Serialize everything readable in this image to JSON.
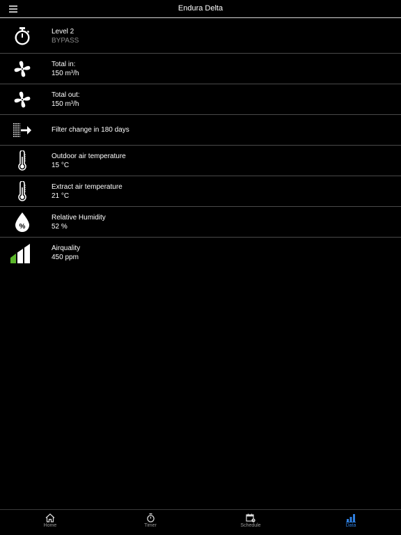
{
  "header": {
    "title": "Endura Delta",
    "menu_icon": "hamburger-menu-icon"
  },
  "rows": [
    {
      "icon": "stopwatch-icon",
      "line1": "Level 2",
      "line2": "BYPASS"
    },
    {
      "icon": "fan-icon",
      "line1": "Total in:",
      "line2_value": "150 m",
      "line2_sup": "3",
      "line2_unit": "/h"
    },
    {
      "icon": "fan-icon",
      "line1": "Total out:",
      "line2_value": "150 m",
      "line2_sup": "3",
      "line2_unit": "/h"
    },
    {
      "icon": "filter-icon",
      "line1": "Filter change in 180 days"
    },
    {
      "icon": "thermometer-icon",
      "line1": "Outdoor air temperature",
      "line2": "15 °C"
    },
    {
      "icon": "thermometer-icon",
      "line1": "Extract air temperature",
      "line2": "21 °C"
    },
    {
      "icon": "humidity-drop-icon",
      "drop_symbol": "%",
      "line1": "Relative Humidity",
      "line2": "52 %"
    },
    {
      "icon": "air-quality-bars-icon",
      "line1": "Airquality",
      "line2": "450 ppm",
      "level_active_bars": 1,
      "level_total_bars": 3
    }
  ],
  "tabs": [
    {
      "label": "Home",
      "icon": "home-icon",
      "active": false
    },
    {
      "label": "Timer",
      "icon": "stopwatch-icon",
      "active": false
    },
    {
      "label": "Schedule",
      "icon": "calendar-icon",
      "active": false
    },
    {
      "label": "Data",
      "icon": "bar-chart-icon",
      "active": true
    }
  ],
  "colors": {
    "background": "#000000",
    "text": "#ffffff",
    "muted_text": "#8a8a8a",
    "active_tab": "#2f7fe0",
    "air_quality_good": "#5ab52a"
  }
}
